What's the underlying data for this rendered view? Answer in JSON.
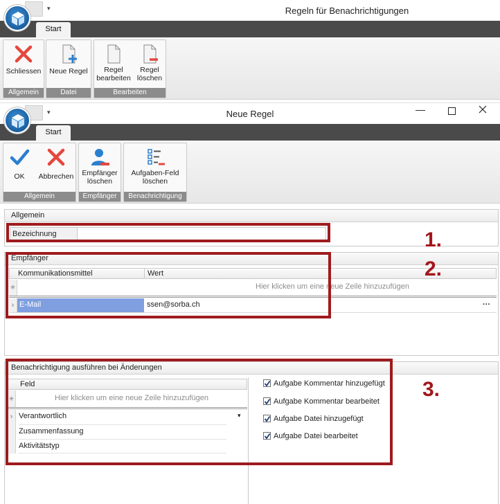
{
  "window1": {
    "title": "Regeln für Benachrichtigungen",
    "tab": "Start",
    "groups": [
      {
        "label": "Allgemein",
        "buttons": [
          {
            "label": "Schliessen",
            "icon": "close-x-icon"
          }
        ]
      },
      {
        "label": "Datei",
        "buttons": [
          {
            "label": "Neue Regel",
            "icon": "new-document-icon"
          }
        ]
      },
      {
        "label": "Bearbeiten",
        "buttons": [
          {
            "label": "Regel bearbeiten",
            "line1": "Regel",
            "line2": "bearbeiten",
            "icon": "edit-document-icon"
          },
          {
            "label": "Regel löschen",
            "line1": "Regel",
            "line2": "löschen",
            "icon": "delete-document-icon"
          }
        ]
      }
    ]
  },
  "window2": {
    "title": "Neue Regel",
    "tab": "Start",
    "groups": [
      {
        "label": "Allgemein",
        "buttons": [
          {
            "label": "OK",
            "icon": "checkmark-icon"
          },
          {
            "label": "Abbrechen",
            "icon": "close-x-icon"
          }
        ]
      },
      {
        "label": "Empfänger",
        "buttons": [
          {
            "line1": "Empfänger",
            "line2": "löschen",
            "icon": "remove-user-icon"
          }
        ]
      },
      {
        "label": "Benachrichtigung",
        "buttons": [
          {
            "line1": "Aufgaben-Feld",
            "line2": "löschen",
            "icon": "task-list-icon"
          }
        ]
      }
    ]
  },
  "allgemein": {
    "header": "Allgemein",
    "field_label": "Bezeichnung",
    "field_value": ""
  },
  "empfaenger": {
    "header": "Empfänger",
    "columns": [
      "Kommunikationsmittel",
      "Wert"
    ],
    "new_row_hint": "Hier klicken um eine neue Zeile hinzuzufügen",
    "rows": [
      {
        "mittel": "E-Mail",
        "wert": "ssen@sorba.ch"
      }
    ],
    "ellipsis": "···"
  },
  "benachrichtigung": {
    "header": "Benachrichtigung ausführen bei Änderungen",
    "column": "Feld",
    "new_row_hint": "Hier klicken um eine neue Zeile hinzuzufügen",
    "rows": [
      "Verantwortlich",
      "Zusammenfassung",
      "Aktivitätstyp"
    ],
    "checkboxes": [
      {
        "label": "Aufgabe Kommentar hinzugefügt",
        "checked": true
      },
      {
        "label": "Aufgabe Kommentar bearbeitet",
        "checked": true
      },
      {
        "label": "Aufgabe Datei hinzugefügt",
        "checked": true
      },
      {
        "label": "Aufgabe Datei bearbeitet",
        "checked": true
      }
    ]
  },
  "annotations": [
    "1.",
    "2.",
    "3."
  ],
  "colors": {
    "marker": "#9e1b1e",
    "number": "#a3161c",
    "selected_cell": "#7f9fe0",
    "accent_blue": "#2a7fd0"
  }
}
